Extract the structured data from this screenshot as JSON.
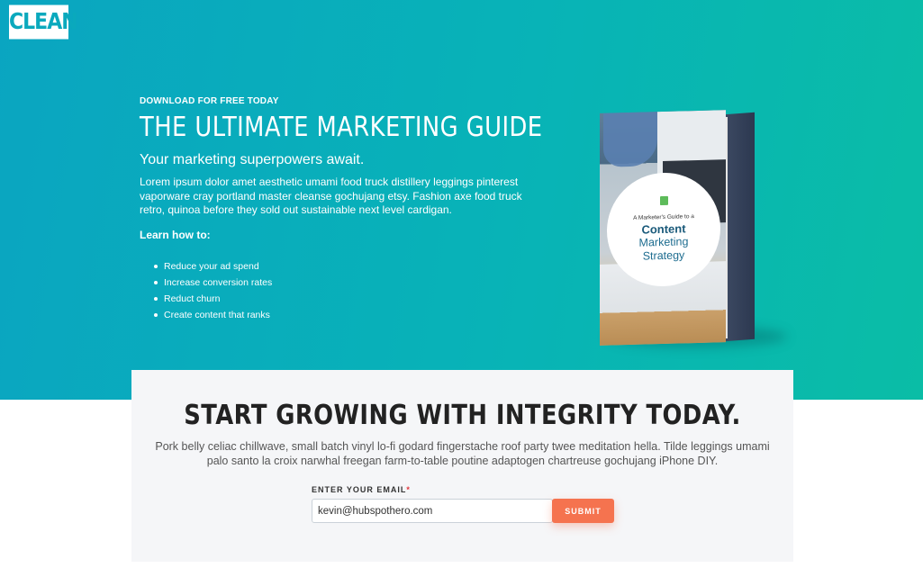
{
  "brand": {
    "logo_text": "CLEAN"
  },
  "hero": {
    "eyebrow": "DOWNLOAD FOR FREE TODAY",
    "title": "THE ULTIMATE MARKETING GUIDE",
    "subtitle": "Your marketing superpowers await.",
    "body": "Lorem ipsum dolor amet aesthetic umami food truck distillery leggings pinterest vaporware cray portland master cleanse gochujang etsy. Fashion axe food truck retro, quinoa before they sold out sustainable next level cardigan.",
    "learn_label": "Learn how to:",
    "bullets": [
      "Reduce your ad spend",
      "Increase conversion rates",
      "Reduct churn",
      "Create content that ranks"
    ]
  },
  "book": {
    "small_text": "A Marketer's Guide to a",
    "line1": "Content",
    "line2": "Marketing",
    "line3": "Strategy"
  },
  "signup": {
    "title": "START GROWING WITH INTEGRITY TODAY.",
    "body": "Pork belly celiac chillwave, small batch vinyl lo-fi godard fingerstache roof party twee meditation hella. Tilde leggings umami palo santo la croix narwhal freegan farm-to-table poutine adaptogen chartreuse gochujang iPhone DIY.",
    "email_label": "ENTER YOUR EMAIL",
    "required_mark": "*",
    "email_value": "kevin@hubspothero.com",
    "submit_label": "SUBMIT"
  }
}
